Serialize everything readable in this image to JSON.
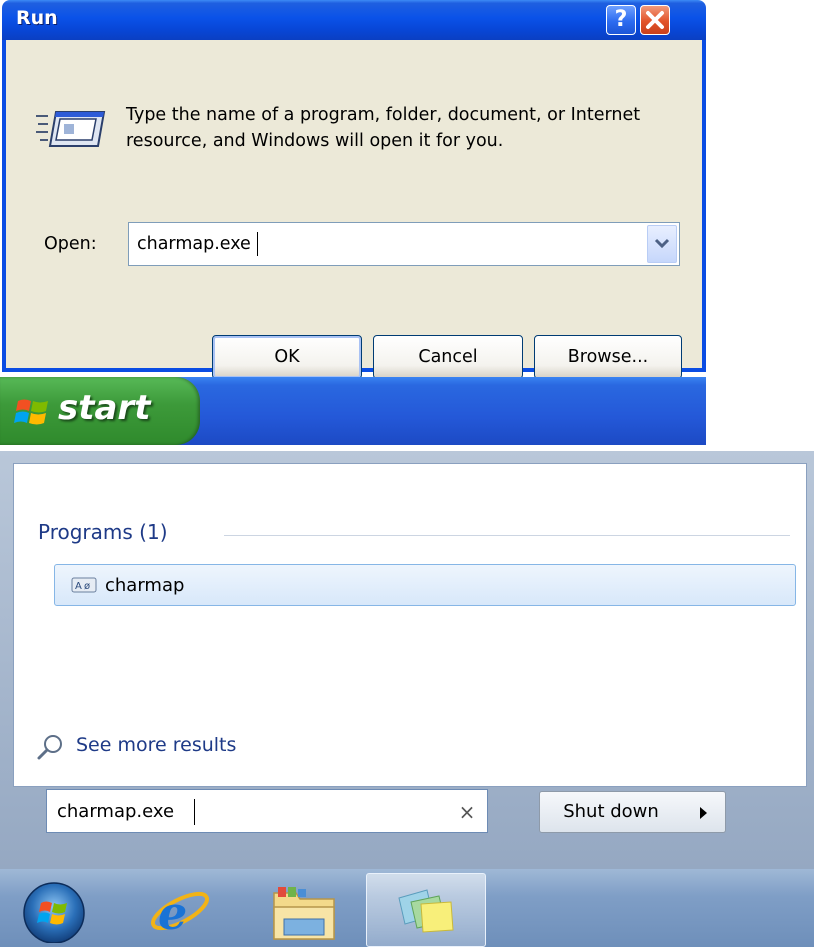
{
  "xp_run_dialog": {
    "title": "Run",
    "help_button": "?",
    "description": "Type the name of a program, folder, document, or Internet resource, and Windows will open it for you.",
    "open_label": "Open:",
    "open_value": "charmap.exe",
    "ok_label": "OK",
    "cancel_label": "Cancel",
    "browse_label": "Browse..."
  },
  "xp_taskbar": {
    "start_label": "start"
  },
  "win7_start_menu": {
    "programs_header": "Programs (1)",
    "results": [
      {
        "label": "charmap"
      }
    ],
    "see_more": "See more results",
    "search_value": "charmap.exe",
    "clear_glyph": "×",
    "shutdown_label": "Shut down"
  },
  "win7_taskbar": {
    "icons": [
      "windows-orb-icon",
      "internet-explorer-icon",
      "windows-explorer-icon",
      "sticky-notes-icon"
    ]
  },
  "colors": {
    "xp_title_blue": "#0a52e8",
    "xp_dialog_bg": "#ece9d8",
    "xp_start_green": "#3d9a3a",
    "w7_header_blue": "#1e3a87",
    "w7_selection": "#d8e8fa"
  }
}
